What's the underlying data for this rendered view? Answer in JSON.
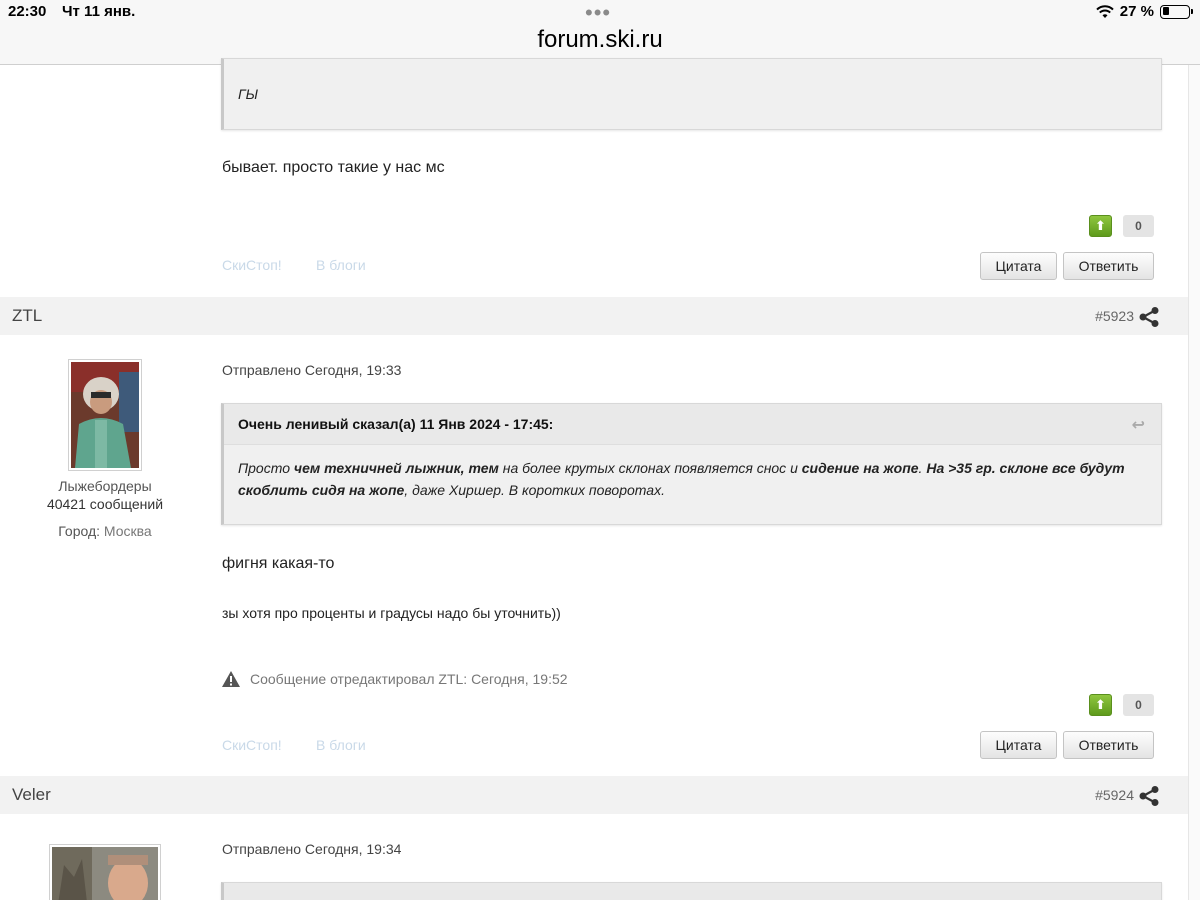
{
  "status_bar": {
    "time": "22:30",
    "date": "Чт 11 янв.",
    "dots": "•••",
    "battery": "27 %",
    "battery_level": 0.27
  },
  "browser": {
    "address": "forum.ski.ru"
  },
  "prev_post": {
    "quote_text": "ГЫ",
    "body": "бывает. просто такие у нас мс",
    "rep_count": "0",
    "link_skistop": "СкиСтоп!",
    "link_blog": "В блоги",
    "quote_button": "Цитата",
    "reply_button": "Ответить"
  },
  "posts": [
    {
      "author": "ZTL",
      "number": "#5923",
      "group": "Лыжебордеры",
      "messages": "40421 сообщений",
      "city_label": "Город:",
      "city": "Москва",
      "sent": "Отправлено Сегодня, 19:33",
      "quote_head": "Очень ленивый сказал(а) 11 Янв 2024 - 17:45:",
      "quote_parts": {
        "p1": "Просто ",
        "b1": "чем техничней лыжник, тем",
        "p2": " на более крутых склонах появляется снос и ",
        "b2": "сидение на жопе",
        "p3": ". ",
        "b3": "На >35 гр. склоне все будут скоблить сидя на жопе",
        "p4": ", даже Хиршер. В коротких поворотах."
      },
      "body": "фигня какая-то",
      "body2": "зы хотя про проценты и градусы надо бы уточнить))",
      "edited": "Сообщение отредактировал ZTL: Сегодня, 19:52",
      "rep_count": "0",
      "link_skistop": "СкиСтоп!",
      "link_blog": "В блоги",
      "quote_button": "Цитата",
      "reply_button": "Ответить"
    },
    {
      "author": "Veler",
      "number": "#5924",
      "sent": "Отправлено Сегодня, 19:34"
    }
  ]
}
